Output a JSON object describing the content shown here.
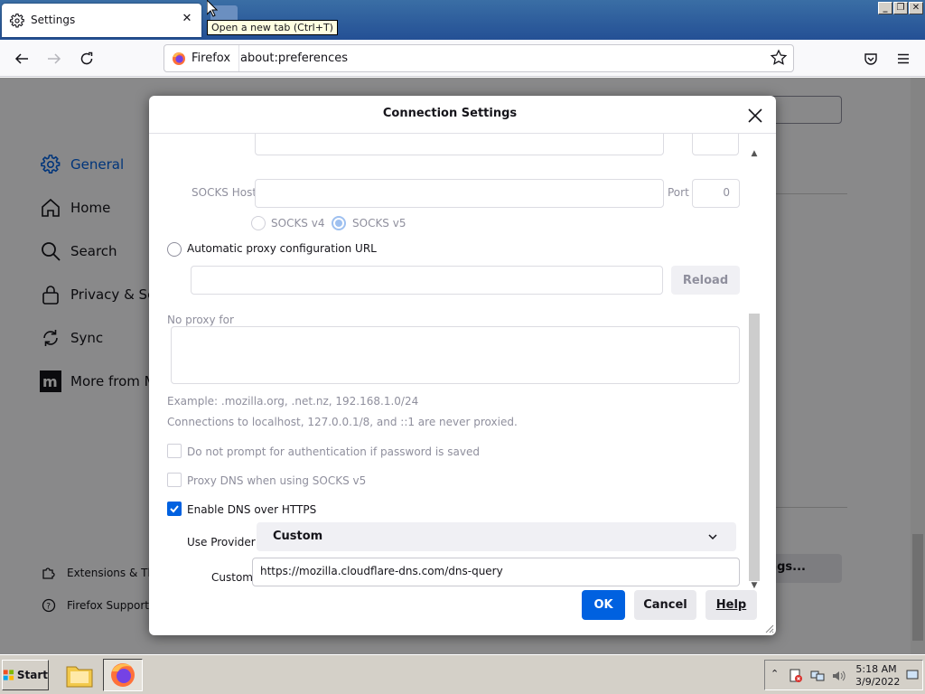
{
  "browser": {
    "tab_title": "Settings",
    "tooltip": "Open a new tab (Ctrl+T)",
    "identity_label": "Firefox",
    "url": "about:preferences"
  },
  "settings_nav": {
    "items": [
      {
        "label": "General",
        "icon": "gear-icon",
        "selected": true
      },
      {
        "label": "Home",
        "icon": "home-icon"
      },
      {
        "label": "Search",
        "icon": "search-icon"
      },
      {
        "label": "Privacy & Sec",
        "icon": "lock-icon"
      },
      {
        "label": "Sync",
        "icon": "sync-icon"
      },
      {
        "label": "More from M",
        "icon": "mozilla-icon"
      }
    ],
    "footer": [
      {
        "label": "Extensions & Th",
        "icon": "puzzle-icon"
      },
      {
        "label": "Firefox Support",
        "icon": "help-icon"
      }
    ],
    "bg_button_label": "ngs..."
  },
  "dialog": {
    "title": "Connection Settings",
    "socks_host_label": "SOCKS Host",
    "socks_host_value": "",
    "port_label": "Port",
    "port_value": "0",
    "socks_v4_label": "SOCKS v4",
    "socks_v5_label": "SOCKS v5",
    "socks_selected": "SOCKS v5",
    "auto_proxy_label": "Automatic proxy configuration URL",
    "auto_proxy_url": "",
    "reload_label": "Reload",
    "no_proxy_label": "No proxy for",
    "no_proxy_value": "",
    "example_text": "Example: .mozilla.org, .net.nz, 192.168.1.0/24",
    "localhost_text": "Connections to localhost, 127.0.0.1/8, and ::1 are never proxied.",
    "no_prompt_auth_label": "Do not prompt for authentication if password is saved",
    "no_prompt_auth_checked": false,
    "proxy_dns_label": "Proxy DNS when using SOCKS v5",
    "proxy_dns_checked": false,
    "doh_label": "Enable DNS over HTTPS",
    "doh_checked": true,
    "use_provider_label": "Use Provider",
    "provider_value": "Custom",
    "custom_label": "Custom",
    "custom_url": "https://mozilla.cloudflare-dns.com/dns-query",
    "ok_label": "OK",
    "cancel_label": "Cancel",
    "help_label": "Help"
  },
  "taskbar": {
    "start_label": "Start",
    "time": "5:18 AM",
    "date": "3/9/2022"
  },
  "colors": {
    "accent": "#0061e0",
    "titlebar": "#245095",
    "taskbar": "#d4d0c8"
  }
}
